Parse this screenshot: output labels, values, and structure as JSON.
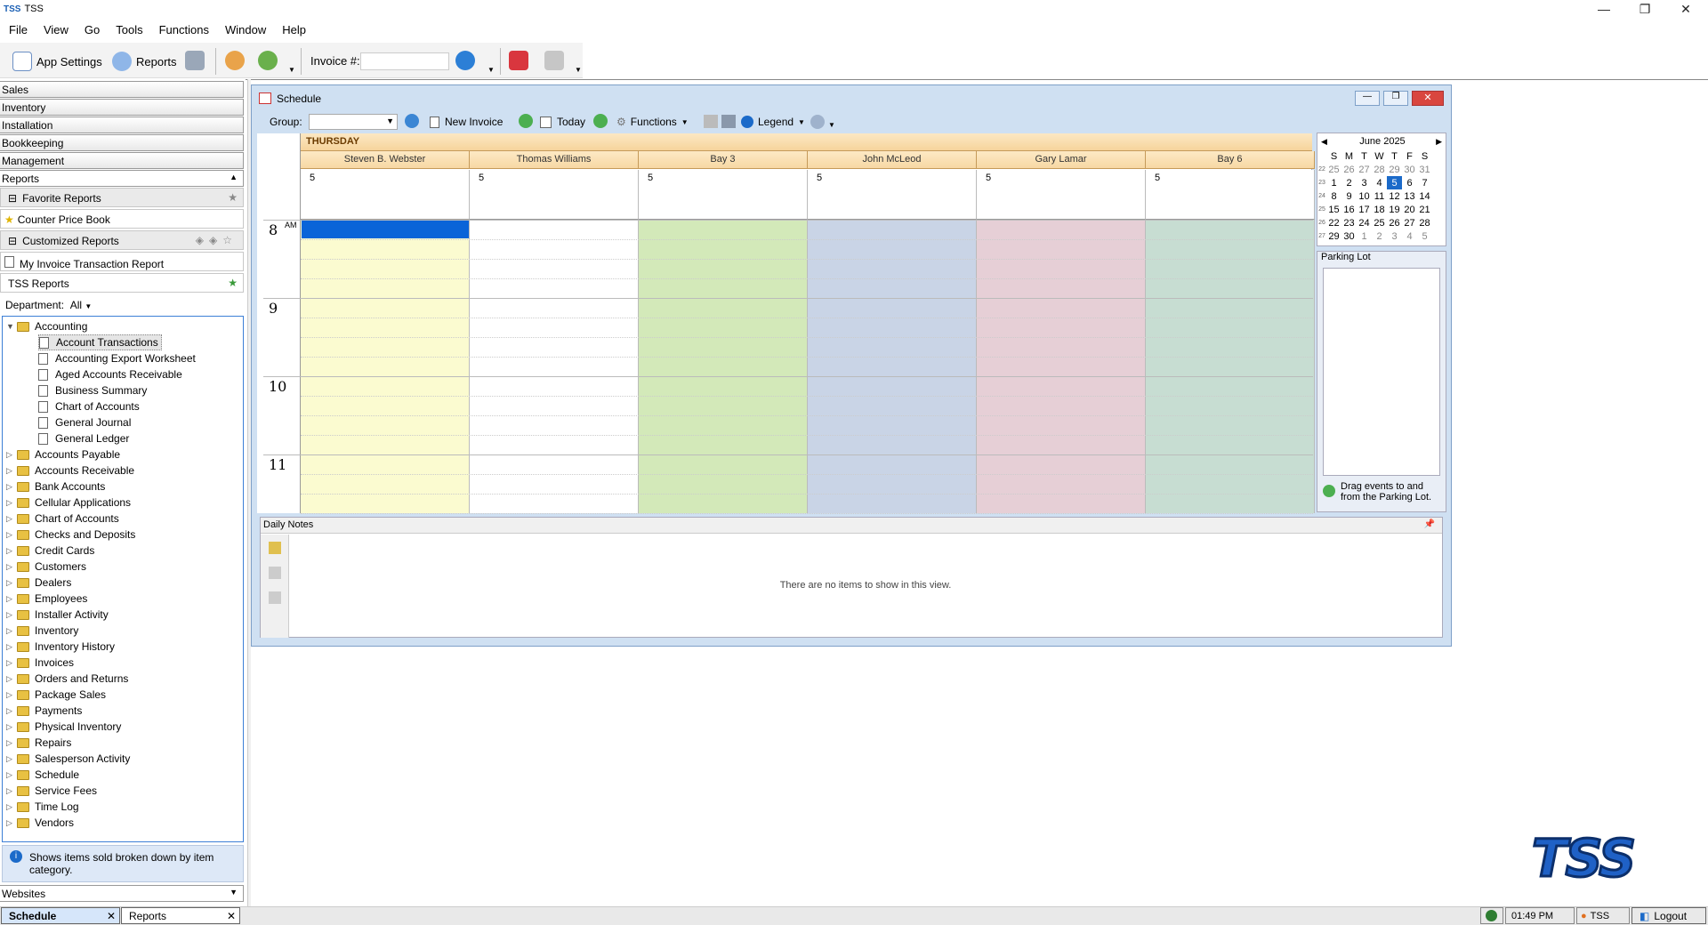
{
  "window": {
    "app_logo": "TSS",
    "title": "TSS",
    "minimize": "—",
    "restore": "❐",
    "close": "✕"
  },
  "menu": [
    "File",
    "View",
    "Go",
    "Tools",
    "Functions",
    "Window",
    "Help"
  ],
  "toolbar": {
    "app_settings": "App Settings",
    "reports": "Reports",
    "invoice_label": "Invoice #:",
    "invoice_value": ""
  },
  "nav": {
    "sales": "Sales",
    "inventory": "Inventory",
    "installation": "Installation",
    "bookkeeping": "Bookkeeping",
    "management": "Management",
    "reports": "Reports",
    "websites": "Websites"
  },
  "reports_panel": {
    "favorite_header": "Favorite Reports",
    "favorite_item": "Counter Price Book",
    "customized_header": "Customized Reports",
    "customized_item": "My Invoice Transaction Report",
    "tss_header": "TSS Reports",
    "department_label": "Department:",
    "department_value": "All"
  },
  "tree": {
    "root": "Accounting",
    "children": [
      "Account Transactions",
      "Accounting Export Worksheet",
      "Aged Accounts Receivable",
      "Business Summary",
      "Chart of Accounts",
      "General Journal",
      "General Ledger"
    ],
    "folders": [
      "Accounts Payable",
      "Accounts Receivable",
      "Bank Accounts",
      "Cellular Applications",
      "Chart of Accounts",
      "Checks and Deposits",
      "Credit Cards",
      "Customers",
      "Dealers",
      "Employees",
      "Installer Activity",
      "Inventory",
      "Inventory History",
      "Invoices",
      "Orders and Returns",
      "Package Sales",
      "Payments",
      "Physical Inventory",
      "Repairs",
      "Salesperson Activity",
      "Schedule",
      "Service Fees",
      "Time Log",
      "Vendors"
    ]
  },
  "tip": "Shows items sold broken down by item category.",
  "schedule": {
    "title": "Schedule",
    "group_label": "Group:",
    "new_invoice": "New Invoice",
    "today": "Today",
    "functions": "Functions",
    "legend": "Legend",
    "day_name": "THURSDAY",
    "columns": [
      {
        "name": "Steven B. Webster",
        "day": "5",
        "color": "#fbfbd0"
      },
      {
        "name": "Thomas Williams",
        "day": "5",
        "color": "#ffffff"
      },
      {
        "name": "Bay 3",
        "day": "5",
        "color": "#d3e9b9"
      },
      {
        "name": "John McLeod",
        "day": "5",
        "color": "#c9d4e6"
      },
      {
        "name": "Gary Lamar",
        "day": "5",
        "color": "#e6cfd6"
      },
      {
        "name": "Bay 6",
        "day": "5",
        "color": "#c7ddd2"
      }
    ],
    "hours": [
      "8",
      "9",
      "10",
      "11"
    ],
    "am": "AM",
    "selected_color": "#0a64d8"
  },
  "calendar": {
    "month": "June 2025",
    "weekdays": [
      "S",
      "M",
      "T",
      "W",
      "T",
      "F",
      "S"
    ],
    "weeks": [
      {
        "wk": "22",
        "days": [
          "25",
          "26",
          "27",
          "28",
          "29",
          "30",
          "31"
        ]
      },
      {
        "wk": "23",
        "days": [
          "1",
          "2",
          "3",
          "4",
          "5",
          "6",
          "7"
        ]
      },
      {
        "wk": "24",
        "days": [
          "8",
          "9",
          "10",
          "11",
          "12",
          "13",
          "14"
        ]
      },
      {
        "wk": "25",
        "days": [
          "15",
          "16",
          "17",
          "18",
          "19",
          "20",
          "21"
        ]
      },
      {
        "wk": "26",
        "days": [
          "22",
          "23",
          "24",
          "25",
          "26",
          "27",
          "28"
        ]
      },
      {
        "wk": "27",
        "days": [
          "29",
          "30",
          "1",
          "2",
          "3",
          "4",
          "5"
        ]
      }
    ],
    "today": "5"
  },
  "parking_lot": {
    "title": "Parking Lot",
    "hint": "Drag events to and from the Parking Lot."
  },
  "daily_notes": {
    "title": "Daily Notes",
    "empty": "There are no items to show in this view."
  },
  "tabs": [
    {
      "label": "Schedule",
      "close": "✕"
    },
    {
      "label": "Reports",
      "close": "✕"
    }
  ],
  "status": {
    "time": "01:49 PM",
    "user": "TSS",
    "logout": "Logout"
  },
  "brand": "TSS"
}
